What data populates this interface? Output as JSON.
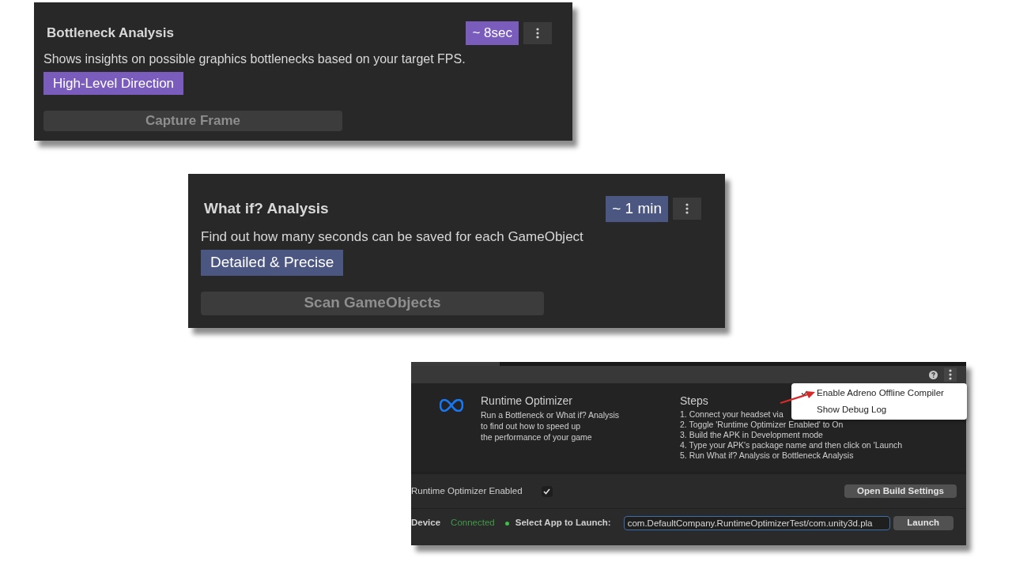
{
  "analysis_panels": [
    {
      "title": "Bottleneck Analysis",
      "duration": "~ 8sec",
      "description": "Shows insights on possible graphics bottlenecks based on your target FPS.",
      "tag": "High-Level Direction",
      "color": "#7a5cbd",
      "action": "Capture Frame"
    },
    {
      "title": "What if? Analysis",
      "duration": "~ 1 min",
      "description": "Find out how many seconds can be saved for each GameObject",
      "tag": "Detailed & Precise",
      "color": "#4c5781",
      "action": "Scan GameObjects"
    }
  ],
  "optimizer": {
    "title": "Runtime Optimizer",
    "description": [
      "Run a Bottleneck or What if? Analysis",
      "to find out how to speed up",
      "the performance of your game"
    ],
    "steps_title": "Steps",
    "steps": [
      "1. Connect your headset via",
      "2. Toggle 'Runtime Optimizer Enabled' to On",
      "3. Build the APK in Development mode",
      "4. Type your APK's package name and then click on 'Launch",
      "5. Run What if? Analysis or Bottleneck Analysis"
    ],
    "enabled_label": "Runtime Optimizer Enabled",
    "enabled_checked": true,
    "build_button": "Open Build Settings",
    "device_label": "Device",
    "device_status": "Connected",
    "device_connected": true,
    "app_label": "Select App to Launch:",
    "app_value": "com.DefaultCompany.RuntimeOptimizerTest/com.unity3d.pla",
    "launch_button": "Launch",
    "menu": [
      {
        "label": "Enable Adreno Offline Compiler",
        "checked": true
      },
      {
        "label": "Show Debug Log",
        "checked": false
      }
    ]
  }
}
